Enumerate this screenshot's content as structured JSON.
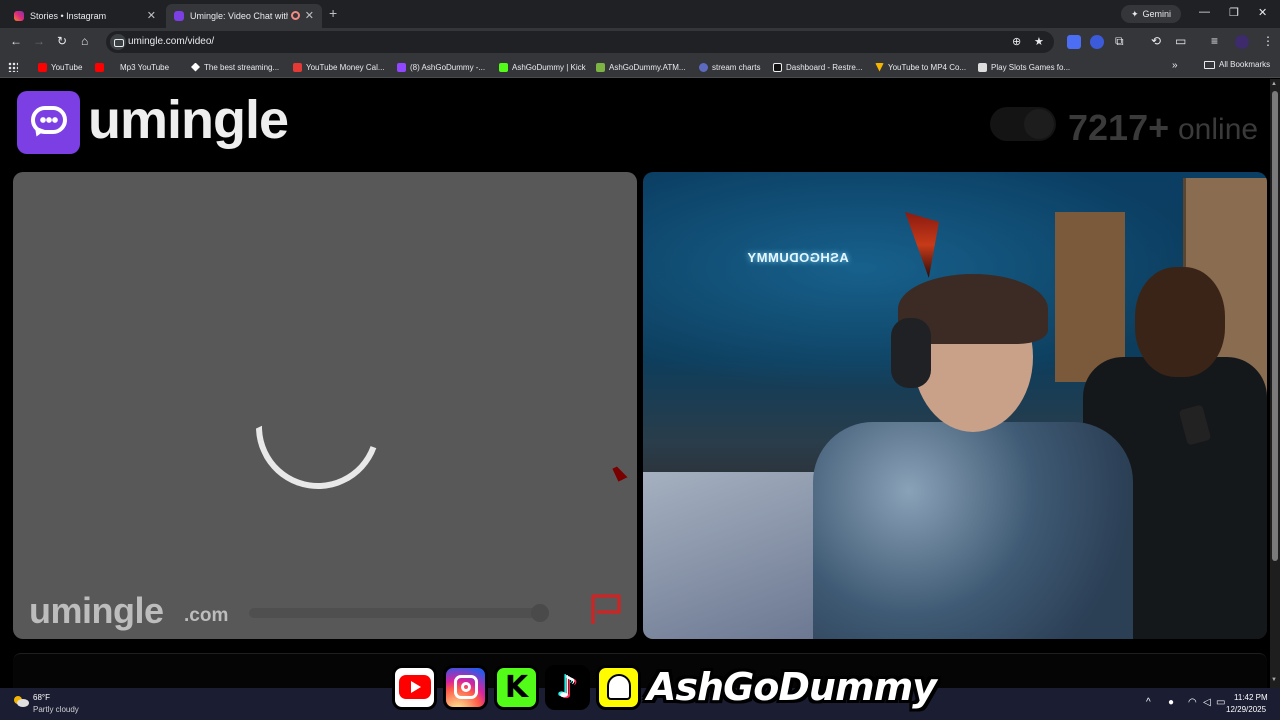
{
  "browser": {
    "tabs": [
      {
        "title": "Stories • Instagram",
        "active": false
      },
      {
        "title": "Umingle: Video Chat with S",
        "active": true
      }
    ],
    "gemini_label": "Gemini",
    "url": "umingle.com/video/",
    "bookmarks": [
      {
        "label": "YouTube",
        "color": "#ff0000"
      },
      {
        "label": "Mp3 YouTube",
        "color": "#ff0000"
      },
      {
        "label": "The best streaming...",
        "color": "#ffffff"
      },
      {
        "label": "YouTube Money Cal...",
        "color": "#e53935"
      },
      {
        "label": "(8) AshGoDummy -...",
        "color": "#9146ff"
      },
      {
        "label": "AshGoDummy | Kick",
        "color": "#53fc18"
      },
      {
        "label": "AshGoDummy.ATM...",
        "color": "#7cb342"
      },
      {
        "label": "stream charts",
        "color": "#5c6bc0"
      },
      {
        "label": "Dashboard - Restre...",
        "color": "#111111"
      },
      {
        "label": "YouTube to MP4 Co...",
        "color": "#f4b400"
      },
      {
        "label": "Play Slots Games fo...",
        "color": "#dddddd"
      }
    ],
    "all_bookmarks": "All Bookmarks"
  },
  "site": {
    "brand": "umingle",
    "online_count": "7217+",
    "online_label": "online",
    "accent": "#7b3fe4"
  },
  "video_left": {
    "watermark_main": "umingle",
    "watermark_sub": ".com",
    "report_flag_color": "#d32f2f"
  },
  "video_right": {
    "neon_sign": "ASHGODUMMY"
  },
  "overlay": {
    "icons": [
      "youtube-icon",
      "instagram-icon",
      "kick-icon",
      "tiktok-icon",
      "snapchat-icon"
    ],
    "kick_glyph": "K",
    "tiktok_glyph": "♪",
    "name": "AshGoDummy"
  },
  "taskbar": {
    "temp": "68°F",
    "weather": "Partly cloudy",
    "time": "11:42 PM",
    "date": "12/29/2025"
  }
}
